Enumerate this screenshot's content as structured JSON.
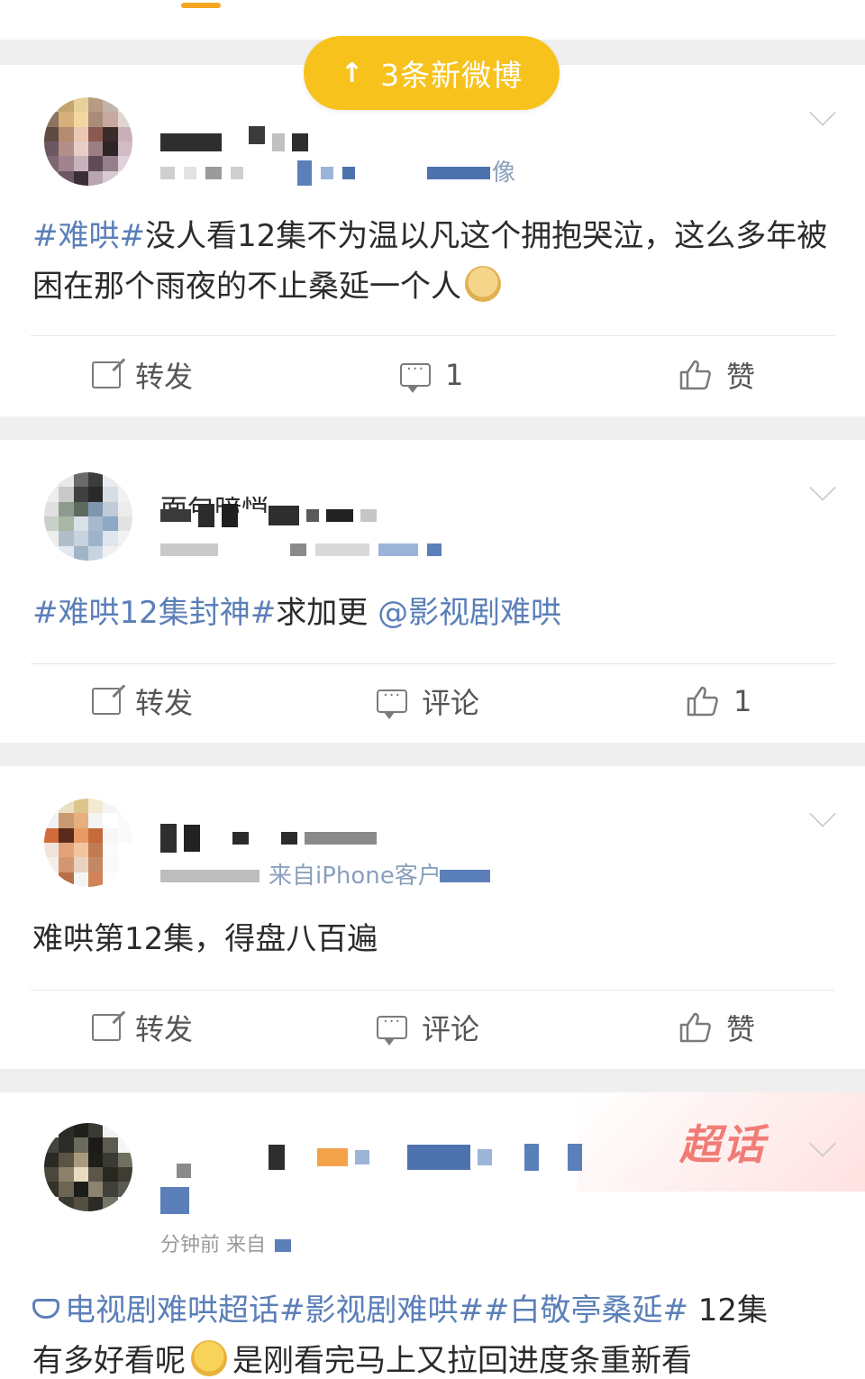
{
  "colors": {
    "accent_yellow": "#f8c21d",
    "link_blue": "#5b7fb8",
    "text": "#2b2b2b",
    "muted": "#555555",
    "background": "#efefef",
    "chaohua_red": "#f07c75"
  },
  "header": {
    "new_posts_arrow": "↑",
    "new_posts_label": "3条新微博"
  },
  "posts": [
    {
      "meta_fragment": "像",
      "text": {
        "tag": "#难哄#",
        "body": "没人看12集不为温以凡这个拥抱哭泣，这么多年被困在那个雨夜的不止桑延一个人"
      },
      "emoji_icon": "crying-dog-emoji",
      "actions": {
        "repost": "转发",
        "comment": "1",
        "like": "赞"
      }
    },
    {
      "username_fragment": "面包暗悄",
      "text": {
        "tag": "#难哄12集封神#",
        "body": "求加更",
        "mention": "@影视剧难哄"
      },
      "actions": {
        "repost": "转发",
        "comment": "评论",
        "like": "1"
      }
    },
    {
      "meta_fragment": "来自iPhone客户",
      "text": {
        "body": "难哄第12集，得盘八百遍"
      },
      "actions": {
        "repost": "转发",
        "comment": "评论",
        "like": "赞"
      }
    },
    {
      "badge": "超话",
      "meta_fragment": "分钟前 来自",
      "text": {
        "tag1": "电视剧难哄超话",
        "tag2": "#影视剧难哄#",
        "tag3": "#白敬亭桑延#",
        "body1": " 12集",
        "body2": "有多好看呢",
        "body3": "是刚看完马上又拉回进度条重新看"
      },
      "emoji_icon": "crying-face-emoji"
    }
  ]
}
